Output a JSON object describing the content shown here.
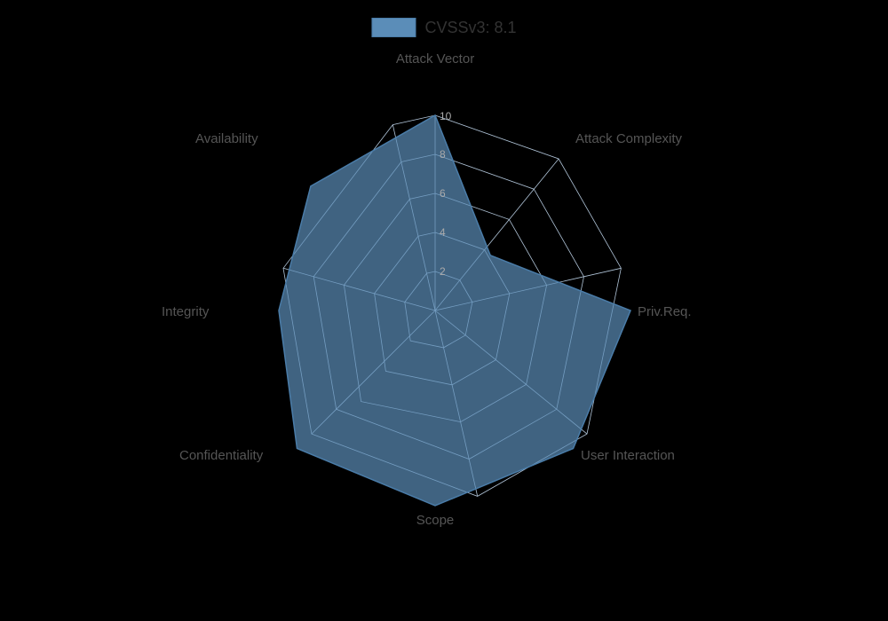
{
  "chart": {
    "title": "CVSSv3: 8.1",
    "legend_color": "#5b8db8",
    "axes": [
      {
        "name": "Attack Vector",
        "value": 10,
        "angle": -90
      },
      {
        "name": "Attack Complexity",
        "value": 4,
        "angle": -38.57
      },
      {
        "name": "Priv.Req.",
        "value": 10,
        "angle": 12.86
      },
      {
        "name": "User Interaction",
        "value": 10,
        "angle": 64.29
      },
      {
        "name": "Scope",
        "value": 10,
        "angle": 115.71
      },
      {
        "name": "Confidentiality",
        "value": 10,
        "angle": 167.14
      },
      {
        "name": "Integrity",
        "value": 8,
        "angle": 218.57
      },
      {
        "name": "Availability",
        "value": 9,
        "angle": 270
      },
      {
        "name": "Attack Vector",
        "value": 10,
        "angle": -90
      }
    ],
    "grid_values": [
      2,
      4,
      6,
      8,
      10
    ],
    "max_value": 10,
    "data_values": {
      "attack_vector": 10,
      "attack_complexity": 4,
      "priv_req": 10,
      "user_interaction": 10,
      "scope": 10,
      "confidentiality": 10,
      "integrity": 8,
      "availability": 9
    }
  }
}
